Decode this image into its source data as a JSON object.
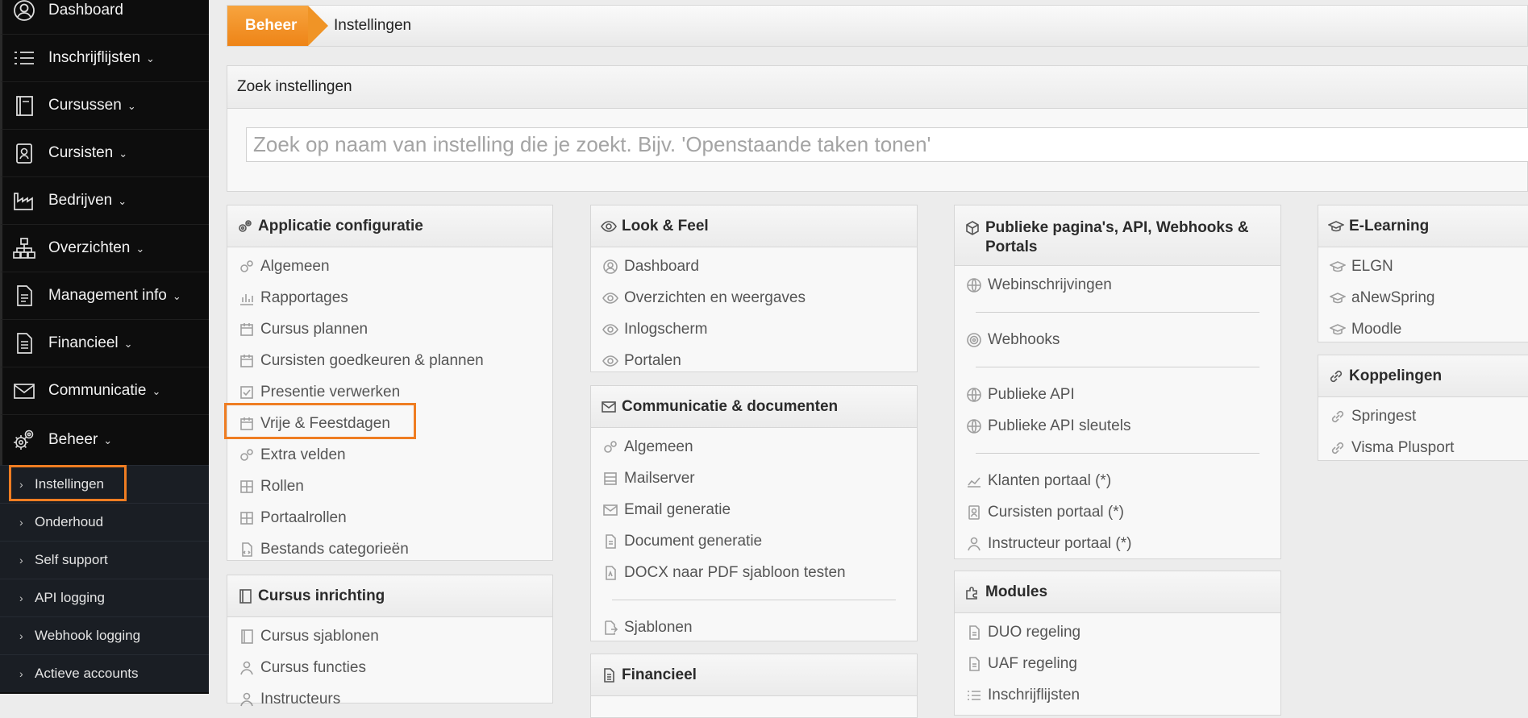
{
  "sidebar": {
    "items": [
      {
        "label": "Dashboard",
        "icon": "user-circle-icon",
        "has_chevron": false
      },
      {
        "label": "Inschrijflijsten",
        "icon": "list-icon",
        "has_chevron": true
      },
      {
        "label": "Cursussen",
        "icon": "book-icon",
        "has_chevron": true
      },
      {
        "label": "Cursisten",
        "icon": "id-badge-icon",
        "has_chevron": true
      },
      {
        "label": "Bedrijven",
        "icon": "factory-icon",
        "has_chevron": true
      },
      {
        "label": "Overzichten",
        "icon": "sitemap-icon",
        "has_chevron": true
      },
      {
        "label": "Management info",
        "icon": "document-icon",
        "has_chevron": true
      },
      {
        "label": "Financieel",
        "icon": "invoice-icon",
        "has_chevron": true
      },
      {
        "label": "Communicatie",
        "icon": "envelope-icon",
        "has_chevron": true
      },
      {
        "label": "Beheer",
        "icon": "gears-icon",
        "has_chevron": true
      }
    ],
    "chevron": "⌄",
    "subitems": [
      {
        "label": "Instellingen"
      },
      {
        "label": "Onderhoud"
      },
      {
        "label": "Self support"
      },
      {
        "label": "API logging"
      },
      {
        "label": "Webhook logging"
      },
      {
        "label": "Actieve accounts"
      }
    ],
    "sub_arrow": "›"
  },
  "breadcrumb": {
    "root": "Beheer",
    "current": "Instellingen"
  },
  "search": {
    "title": "Zoek instellingen",
    "placeholder": "Zoek op naam van instelling die je zoekt. Bijv. 'Openstaande taken tonen'"
  },
  "cards": {
    "applicatie": {
      "title": "Applicatie configuratie",
      "items": [
        "Algemeen",
        "Rapportages",
        "Cursus plannen",
        "Cursisten goedkeuren & plannen",
        "Presentie verwerken",
        "Vrije & Feestdagen",
        "Extra velden",
        "Rollen",
        "Portaalrollen",
        "Bestands categorieën"
      ]
    },
    "cursus_inrichting": {
      "title": "Cursus inrichting",
      "items": [
        "Cursus sjablonen",
        "Cursus functies",
        "Instructeurs"
      ]
    },
    "look_feel": {
      "title": "Look & Feel",
      "items": [
        "Dashboard",
        "Overzichten en weergaves",
        "Inlogscherm",
        "Portalen"
      ]
    },
    "communicatie": {
      "title": "Communicatie & documenten",
      "items": [
        "Algemeen",
        "Mailserver",
        "Email generatie",
        "Document generatie",
        "DOCX naar PDF sjabloon testen",
        "Sjablonen"
      ]
    },
    "financieel": {
      "title": "Financieel"
    },
    "publieke": {
      "title": "Publieke pagina's, API, Webhooks & Portals",
      "items": [
        "Webinschrijvingen",
        "Webhooks",
        "Publieke API",
        "Publieke API sleutels",
        "Klanten portaal (*)",
        "Cursisten portaal (*)",
        "Instructeur portaal (*)"
      ]
    },
    "modules": {
      "title": "Modules",
      "items": [
        "DUO regeling",
        "UAF regeling",
        "Inschrijflijsten"
      ]
    },
    "elearning": {
      "title": "E-Learning",
      "items": [
        "ELGN",
        "aNewSpring",
        "Moodle"
      ]
    },
    "koppelingen": {
      "title": "Koppelingen",
      "items": [
        "Springest",
        "Visma Plusport"
      ]
    }
  },
  "colors": {
    "accent": "#ef7d22",
    "sidebar_bg": "#0d0d0d",
    "submenu_bg": "#1a1e24"
  }
}
